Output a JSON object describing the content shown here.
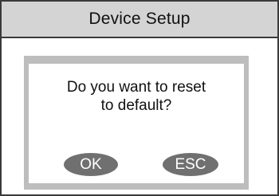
{
  "header": {
    "title": "Device Setup"
  },
  "dialog": {
    "message_line1": "Do you want to reset",
    "message_line2": "to default?",
    "ok_label": "OK",
    "esc_label": "ESC"
  },
  "colors": {
    "title_bar_bg": "#d4d4d4",
    "dialog_frame": "#bdbdbd",
    "button_bg": "#707070",
    "border": "#3a3a3a"
  }
}
